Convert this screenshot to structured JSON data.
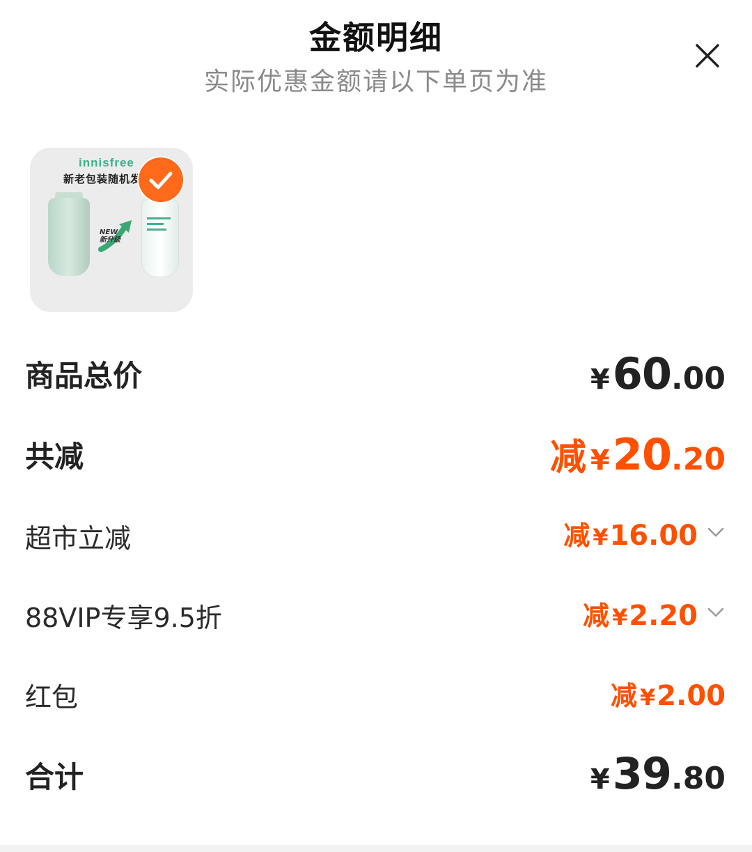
{
  "header": {
    "title": "金额明细",
    "subtitle": "实际优惠金额请以下单页为准"
  },
  "product": {
    "brand": "innisfree",
    "package_note": "新老包装随机发",
    "new_tag": "NEW",
    "upgrade_tag": "新升级",
    "selected": true
  },
  "rows": {
    "subtotal": {
      "label": "商品总价",
      "currency": "¥",
      "int": "60",
      "dec": ".00"
    },
    "total_discount": {
      "label": "共减",
      "prefix": "减",
      "currency": "¥",
      "int": "20",
      "dec": ".20"
    },
    "supermarket_discount": {
      "label": "超市立减",
      "prefix": "减",
      "currency": "¥",
      "int": "16",
      "dec": ".00"
    },
    "vip_discount": {
      "label": "88VIP专享9.5折",
      "prefix": "减",
      "currency": "¥",
      "int": "2",
      "dec": ".20"
    },
    "red_packet": {
      "label": "红包",
      "prefix": "减",
      "currency": "¥",
      "int": "2",
      "dec": ".00"
    },
    "total": {
      "label": "合计",
      "currency": "¥",
      "int": "39",
      "dec": ".80"
    }
  },
  "colors": {
    "accent": "#ff5000",
    "text": "#222222",
    "subtitle": "#8a8a8a",
    "brand_green": "#3fae8a"
  },
  "icons": {
    "close": "close-icon",
    "check": "check-icon",
    "chevron": "chevron-down-icon"
  }
}
